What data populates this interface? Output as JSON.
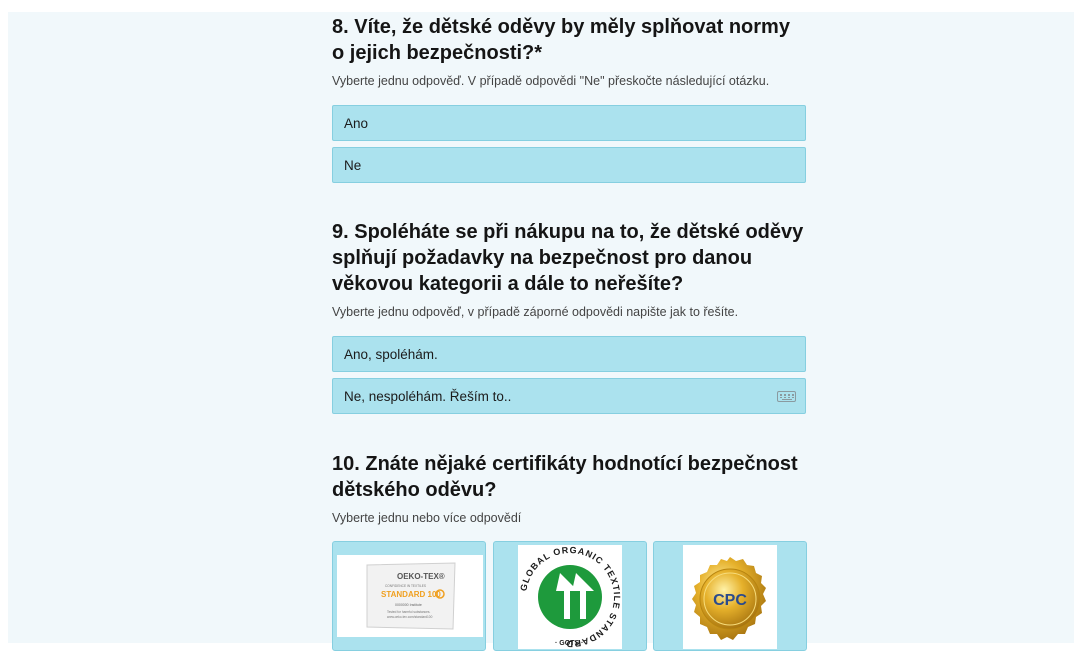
{
  "questions": [
    {
      "title": "8. Víte, že dětské oděvy by měly splňovat normy o jejich bezpečnosti?*",
      "hint": "Vyberte jednu odpověď. V případě odpovědi \"Ne\" přeskočte následující otázku.",
      "options": [
        "Ano",
        "Ne"
      ]
    },
    {
      "title": "9. Spoléháte se při nákupu na to, že dětské oděvy splňují požadavky na bezpečnost pro danou věkovou kategorii a dále to neřešíte?",
      "hint": "Vyberte jednu odpověď, v případě záporné odpovědi napište jak to řešíte.",
      "options": [
        "Ano, spoléhám.",
        "Ne, nespoléhám. Řeším to.."
      ],
      "text_option_icon": "keyboard-icon"
    },
    {
      "title": "10. Znáte nějaké certifikáty hodnotící bezpečnost dětského oděvu?",
      "hint": "Vyberte jednu nebo více odpovědí",
      "certificates": [
        {
          "logo": "oeko-tex-logo",
          "brand": "OEKO-TEX®",
          "line1": "CONFIDENCE IN TEXTILES",
          "standard": "STANDARD 100",
          "line2": "0000000 Institute",
          "line3": "Tested for harmful substances.",
          "line4": "www.oeko-tex.com/standard100"
        },
        {
          "logo": "gots-logo",
          "ring_text": "GLOBAL ORGANIC TEXTILE STANDARD",
          "short": "· GOTS ·"
        },
        {
          "logo": "cpc-seal",
          "text": "CPC"
        }
      ]
    }
  ],
  "colors": {
    "page_bg": "#f1f8fb",
    "option_bg": "#abe2ee",
    "option_border": "#86cfe0",
    "gots_green": "#1e9a3c",
    "cpc_gold": "#d9a21f",
    "cpc_text": "#2b4b8c",
    "oeko_orange": "#f0a020"
  }
}
